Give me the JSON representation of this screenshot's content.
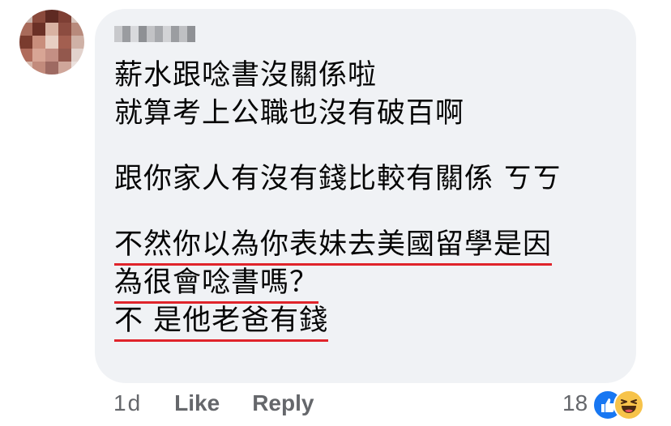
{
  "comment": {
    "lines": [
      "薪水跟唸書沒關係啦",
      "就算考上公職也沒有破百啊",
      "",
      "跟你家人有沒有錢比較有關係 ㄎㄎ",
      "",
      "不然你以為你表妹去美國留學是因",
      "為很會唸書嗎？",
      "不 是他老爸有錢"
    ]
  },
  "actions": {
    "time": "1d",
    "like_label": "Like",
    "reply_label": "Reply"
  },
  "reactions": {
    "count": "18",
    "icons": [
      "like-icon",
      "haha-icon"
    ]
  },
  "colors": {
    "bubble": "#f0f2f5",
    "text": "#050505",
    "meta": "#65676b",
    "underline": "#e0242b",
    "like": "#1877f2",
    "haha": "#f7c34a"
  }
}
